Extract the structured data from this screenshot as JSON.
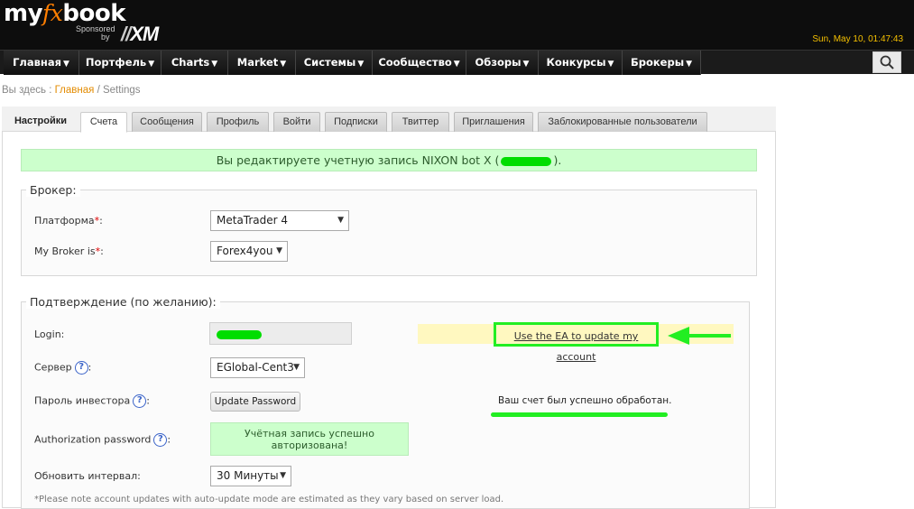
{
  "brand": {
    "logo_prefix": "my",
    "logo_fx": "fx",
    "logo_suffix": "book",
    "sponsored_line1": "Sponsored",
    "sponsored_line2": "by",
    "sponsor": "XM"
  },
  "clock": "Sun, May 10, 01:47:43",
  "nav": [
    {
      "label": "Главная"
    },
    {
      "label": "Портфель"
    },
    {
      "label": "Charts"
    },
    {
      "label": "Market"
    },
    {
      "label": "Системы"
    },
    {
      "label": "Сообщество"
    },
    {
      "label": "Обзоры"
    },
    {
      "label": "Конкурсы"
    },
    {
      "label": "Брокеры"
    }
  ],
  "breadcrumb": {
    "prefix": "Вы здесь :",
    "home": "Главная",
    "separator": "/",
    "current": "Settings"
  },
  "tabs": [
    {
      "label": "Настройки"
    },
    {
      "label": "Счета"
    },
    {
      "label": "Сообщения"
    },
    {
      "label": "Профиль"
    },
    {
      "label": "Войти"
    },
    {
      "label": "Подписки"
    },
    {
      "label": "Твиттер"
    },
    {
      "label": "Приглашения"
    },
    {
      "label": "Заблокированные пользователи"
    }
  ],
  "notice": {
    "prefix": "Вы редактируете учетную запись NIXON bot X (",
    "suffix": ")."
  },
  "broker": {
    "legend": "Брокер:",
    "platform_label": "Платформа",
    "platform_value": "MetaTrader 4",
    "broker_label": "My Broker is",
    "broker_value": "Forex4you",
    "required_mark": "*",
    "colon": ":"
  },
  "confirm": {
    "legend": "Подтверждение (по желанию):",
    "login_label": "Login:",
    "server_label": "Сервер",
    "server_value": "EGlobal-Cent3",
    "investor_label": "Пароль инвестора",
    "update_password_btn": "Update Password",
    "auth_label": "Authorization password",
    "auth_status_line1": "Учётная запись успешно",
    "auth_status_line2": "авторизована!",
    "interval_label": "Обновить интервал:",
    "interval_value": "30 Минуты",
    "ea_link": "Use the EA to update my account",
    "success_text": "Ваш счет был успешно обработан.",
    "help_mark": "?",
    "colon": ":"
  },
  "footnote": "*Please note account updates with auto-update mode are estimated as they vary based on server load.",
  "colors": {
    "accent_orange": "#ff7f00",
    "clock_yellow": "#f5c000",
    "highlight_green": "#22ee22",
    "notice_bg": "#ccffcc"
  }
}
